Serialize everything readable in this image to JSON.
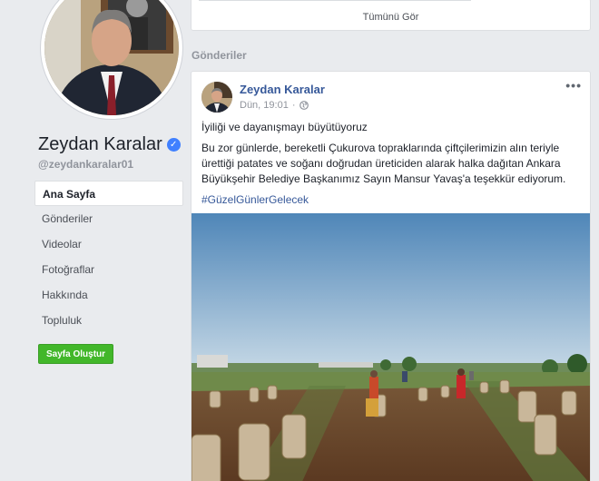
{
  "profile": {
    "name": "Zeydan Karalar",
    "verified_badge": "✓",
    "username": "@zeydankaralar01"
  },
  "nav": {
    "items": [
      {
        "label": "Ana Sayfa",
        "active": true
      },
      {
        "label": "Gönderiler"
      },
      {
        "label": "Videolar"
      },
      {
        "label": "Fotoğraflar"
      },
      {
        "label": "Hakkında"
      },
      {
        "label": "Topluluk"
      }
    ],
    "create_page": "Sayfa Oluştur"
  },
  "top_card": {
    "see_all": "Tümünü Gör"
  },
  "posts_section": {
    "title": "Gönderiler"
  },
  "post": {
    "author": "Zeydan Karalar",
    "timestamp": "Dün, 19:01",
    "privacy_icon": "globe-icon",
    "more_icon": "•••",
    "text_line1": "İyiliği ve dayanışmayı büyütüyoruz",
    "text_line2": "Bu zor günlerde, bereketli Çukurova topraklarında çiftçilerimizin alın teriyle ürettiği patates ve soğanı doğrudan üreticiden alarak halka dağıtan Ankara Büyükşehir Belediye Başkanımız Sayın Mansur Yavaş'a teşekkür ediyorum.",
    "hashtag": "#GüzelGünlerGelecek"
  },
  "colors": {
    "background": "#e9ebee",
    "link_blue": "#365899",
    "verified_blue": "#4080ff",
    "create_green": "#42b72a"
  }
}
